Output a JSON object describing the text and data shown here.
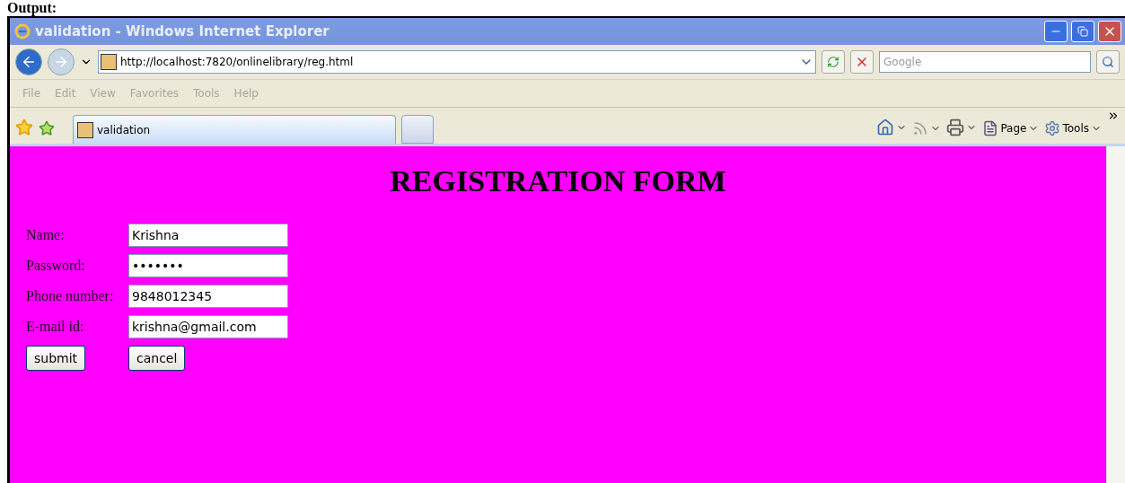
{
  "caption": "Output:",
  "window": {
    "title": "validation - Windows Internet Explorer"
  },
  "address_bar": {
    "url": "http://localhost:7820/onlinelibrary/reg.html"
  },
  "search": {
    "placeholder": "Google"
  },
  "menu": [
    "File",
    "Edit",
    "View",
    "Favorites",
    "Tools",
    "Help"
  ],
  "tabs": [
    {
      "label": "validation",
      "selected": true
    }
  ],
  "command_bar": [
    {
      "kind": "home"
    },
    {
      "kind": "feeds"
    },
    {
      "kind": "print"
    },
    {
      "kind": "page",
      "label": "Page"
    },
    {
      "kind": "tools",
      "label": "Tools"
    }
  ],
  "page": {
    "heading": "REGISTRATION FORM",
    "fields": [
      {
        "label": "Name:",
        "value": "Krishna"
      },
      {
        "label": "Password:",
        "value": "•••••••"
      },
      {
        "label": "Phone number:",
        "value": "9848012345"
      },
      {
        "label": "E-mail id:",
        "value": "krishna@gmail.com"
      }
    ],
    "buttons": [
      "submit",
      "cancel"
    ]
  }
}
